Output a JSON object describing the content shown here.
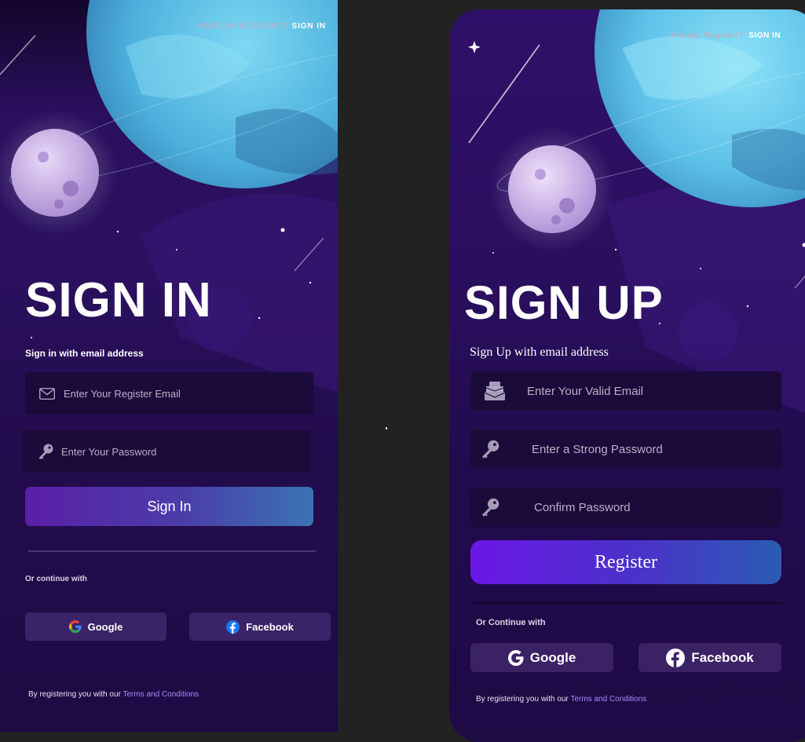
{
  "signin": {
    "top_prompt": "HAVE AN ACCOUNT?",
    "top_link": "SIGN IN",
    "title": "SIGN IN",
    "subtitle": "Sign in with email address",
    "email_placeholder": "Enter Your Register Email",
    "password_placeholder": "Enter Your Password",
    "submit_label": "Sign In",
    "continue_label": "Or continue with",
    "google_label": "Google",
    "facebook_label": "Facebook",
    "terms_prefix": "By registering you with our",
    "terms_link": "Terms and Conditions"
  },
  "signup": {
    "top_prompt": "Already Register?",
    "top_link": "SIGN IN",
    "title": "SIGN UP",
    "subtitle": "Sign Up with email address",
    "email_placeholder": "Enter Your Valid Email",
    "password_placeholder": "Enter a Strong Password",
    "confirm_placeholder": "Confirm Password",
    "submit_label": "Register",
    "continue_label": "Or Continue with",
    "google_label": "Google",
    "facebook_label": "Facebook",
    "terms_prefix": "By registering you with our",
    "terms_link": "Terms and Conditions"
  },
  "colors": {
    "panel_bg": "#2a0f5e",
    "input_bg": "#1b0b3a",
    "accent_purple": "#6b17e6",
    "accent_blue": "#2f6fb8",
    "link": "#a989ff",
    "planet": "#5fc4e8"
  },
  "icons": {
    "email": "envelope-icon",
    "email_alt": "mail-stack-icon",
    "password": "key-icon",
    "google": "google-icon",
    "facebook": "facebook-icon"
  }
}
